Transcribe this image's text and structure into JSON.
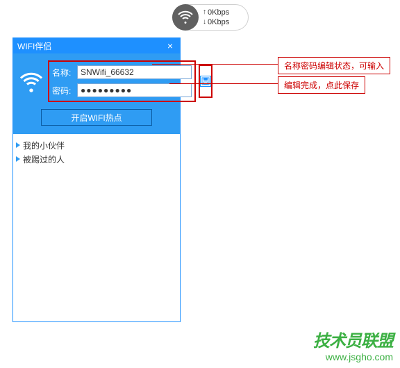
{
  "speed": {
    "up": "0Kbps",
    "down": "0Kbps"
  },
  "window": {
    "title": "WIFI伴侣",
    "close_label": "×",
    "name_label": "名称:",
    "name_value": "SNWifi_66632",
    "password_label": "密码:",
    "password_value": "●●●●●●●●●",
    "start_button": "开启WIFI热点"
  },
  "list": {
    "item1": "我的小伙伴",
    "item2": "被踢过的人"
  },
  "callouts": {
    "edit_hint": "名称密码编辑状态，可输入",
    "save_hint": "编辑完成，点此保存"
  },
  "watermark": {
    "title": "技术员联盟",
    "url": "www.jsgho.com"
  }
}
